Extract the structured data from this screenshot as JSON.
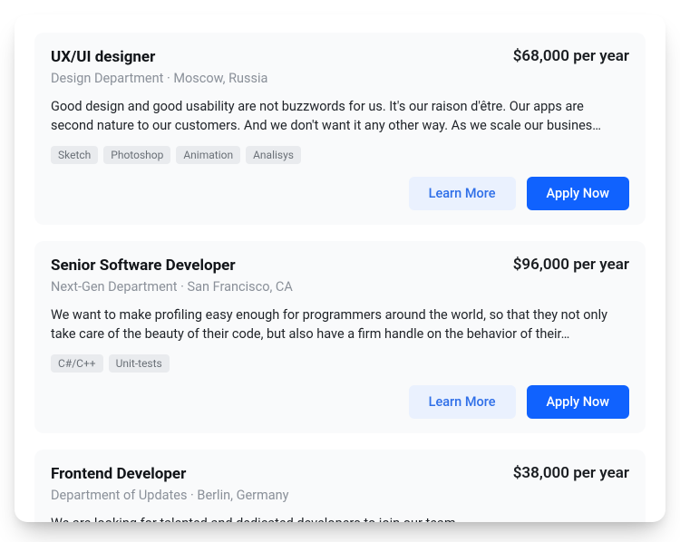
{
  "buttons": {
    "learn_more": "Learn More",
    "apply_now": "Apply Now"
  },
  "jobs": [
    {
      "title": "UX/UI designer",
      "salary": "$68,000 per year",
      "department": "Design Department",
      "location": "Moscow, Russia",
      "description": "Good design and good usability are not buzzwords for us. It's our raison d'être. Our apps are second nature to our customers. And we don't want it any other way. As we scale our busines…",
      "tags": [
        "Sketch",
        "Photoshop",
        "Animation",
        "Analisys"
      ]
    },
    {
      "title": "Senior Software Developer",
      "salary": "$96,000 per year",
      "department": "Next-Gen Department",
      "location": "San Francisco, CA",
      "description": "We want to make profiling easy enough for programmers around the world, so that they not only take care of the beauty of their code, but also have a firm handle on the behavior of their…",
      "tags": [
        "C#/C++",
        "Unit-tests"
      ]
    },
    {
      "title": "Frontend Developer",
      "salary": "$38,000 per year",
      "department": "Department of Updates",
      "location": "Berlin, Germany",
      "description": "We are looking for talented and dedicated developers to join our team.",
      "tags": []
    }
  ]
}
